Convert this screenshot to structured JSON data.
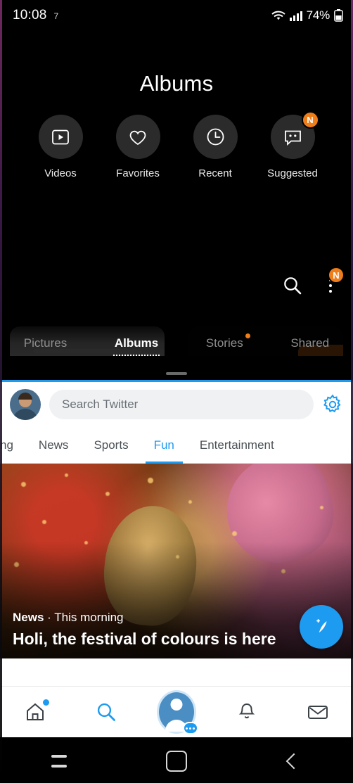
{
  "status_bar": {
    "clock": "10:08",
    "notification_count": "7",
    "battery": "74%",
    "icons": [
      "wifi-icon",
      "signal-icon",
      "battery-icon"
    ]
  },
  "gallery_app": {
    "title": "Albums",
    "quick_items": [
      {
        "label": "Videos",
        "icon": "video-play-icon",
        "badge": ""
      },
      {
        "label": "Favorites",
        "icon": "heart-icon",
        "badge": ""
      },
      {
        "label": "Recent",
        "icon": "clock-icon",
        "badge": ""
      },
      {
        "label": "Suggested",
        "icon": "suggested-faces-icon",
        "badge": "N"
      }
    ],
    "actions": {
      "search_icon": "search-icon",
      "more_icon": "more-vertical-icon",
      "more_badge": "N"
    },
    "tabs": [
      {
        "label": "Pictures",
        "active": false,
        "dot": false
      },
      {
        "label": "Albums",
        "active": true,
        "dot": false
      },
      {
        "label": "Stories",
        "active": false,
        "dot": true
      },
      {
        "label": "Shared",
        "active": false,
        "dot": false
      }
    ]
  },
  "twitter_app": {
    "accent_color": "#1d9bf0",
    "avatar": "user-avatar",
    "search": {
      "placeholder": "Search Twitter",
      "value": ""
    },
    "settings_icon": "gear-icon",
    "tabs": [
      {
        "label": "ng",
        "active": false
      },
      {
        "label": "News",
        "active": false
      },
      {
        "label": "Sports",
        "active": false
      },
      {
        "label": "Fun",
        "active": true
      },
      {
        "label": "Entertainment",
        "active": false
      }
    ],
    "hero": {
      "source": "News",
      "separator": "·",
      "time": "This morning",
      "headline": "Holi, the festival of colours is here"
    },
    "compose_icon": "compose-feather-icon",
    "bottom_nav": [
      {
        "icon": "home-icon",
        "badge_dot": true
      },
      {
        "icon": "search-icon",
        "badge_dot": false
      },
      {
        "icon": "profile-icon",
        "badge_dot": false
      },
      {
        "icon": "bell-icon",
        "badge_dot": false
      },
      {
        "icon": "mail-icon",
        "badge_dot": false
      }
    ]
  },
  "system_nav": {
    "buttons": [
      {
        "icon": "recents-icon"
      },
      {
        "icon": "home-square-icon"
      },
      {
        "icon": "back-chevron-icon"
      }
    ]
  }
}
